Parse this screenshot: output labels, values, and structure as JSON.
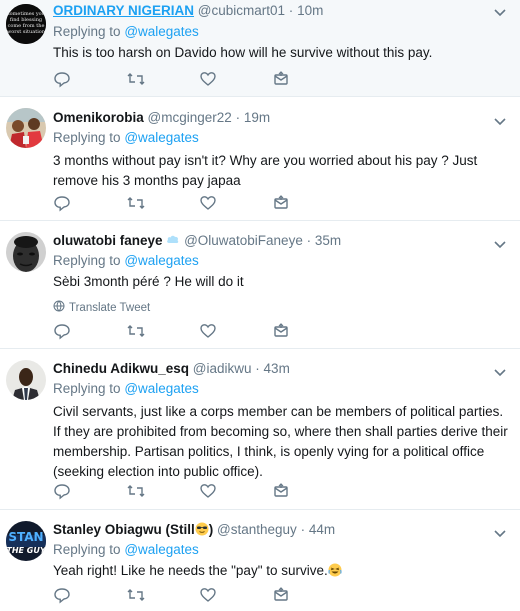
{
  "replying_to_prefix": "Replying to",
  "tweets": [
    {
      "name": "ORDINARY NIGERIAN",
      "handle": "@cubicmart01",
      "dot": "·",
      "time": "10m",
      "replying_to": "@walegates",
      "text": "This is too harsh on Davido how will he survive without this pay.",
      "avatar_text": "sometimes you find blessing come from the worst situation"
    },
    {
      "name": "Omenikorobia",
      "handle": "@mcginger22",
      "dot": "·",
      "time": "19m",
      "replying_to": "@walegates",
      "text": "3 months without pay isn't it? Why are you worried about his pay ? Just remove his 3 months pay japaa"
    },
    {
      "name": "oluwatobi faneye",
      "handle": "@OluwatobiFaneye",
      "dot": "·",
      "time": "35m",
      "replying_to": "@walegates",
      "text": "Sèbi 3month péré ? He will do it",
      "translate_label": "Translate Tweet"
    },
    {
      "name": "Chinedu Adikwu_esq",
      "handle": "@iadikwu",
      "dot": "·",
      "time": "43m",
      "replying_to": "@walegates",
      "text": "Civil servants, just like a corps member can be members of political parties. If they are prohibited from becoming so, where then shall parties derive their membership. Partisan politics, I think, is openly vying for a political office (seeking election into public office)."
    },
    {
      "name": "Stanley Obiagwu (Still",
      "name_suffix": ")",
      "handle": "@stantheguy",
      "dot": "·",
      "time": "44m",
      "replying_to": "@walegates",
      "text": "Yeah right! Like he needs the \"pay\" to survive.",
      "avatar_text": "STAN THE GUY"
    }
  ],
  "colors": {
    "accent": "#1da1f2",
    "muted": "#657786",
    "text": "#14171a",
    "highlight_bg": "#f5f8fa",
    "divider": "#e6ecf0"
  },
  "icons": [
    "reply-icon",
    "retweet-icon",
    "like-icon",
    "dm-icon",
    "chevron-down-icon",
    "globe-icon",
    "verified-badge-icon"
  ]
}
